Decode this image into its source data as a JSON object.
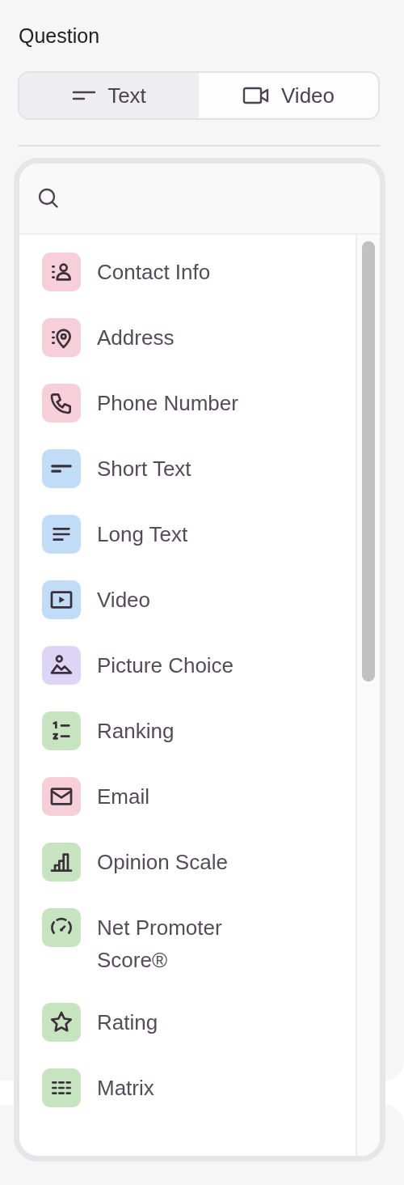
{
  "section_title": "Question",
  "tabs": [
    {
      "label": "Text",
      "selected": true
    },
    {
      "label": "Video",
      "selected": false
    }
  ],
  "question_types": [
    {
      "label": "Contact Info",
      "color": "#f7cfd8"
    },
    {
      "label": "Address",
      "color": "#f7cfd8"
    },
    {
      "label": "Phone Number",
      "color": "#f7cfd8"
    },
    {
      "label": "Short Text",
      "color": "#c0dcf7"
    },
    {
      "label": "Long Text",
      "color": "#c0dcf7"
    },
    {
      "label": "Video",
      "color": "#c0dcf7"
    },
    {
      "label": "Picture Choice",
      "color": "#ddd5f5"
    },
    {
      "label": "Ranking",
      "color": "#c6e4bf"
    },
    {
      "label": "Email",
      "color": "#f7cfd8"
    },
    {
      "label": "Opinion Scale",
      "color": "#c6e4bf"
    },
    {
      "label": "Net Promoter Score®",
      "color": "#c6e4bf"
    },
    {
      "label": "Rating",
      "color": "#c6e4bf"
    },
    {
      "label": "Matrix",
      "color": "#c6e4bf"
    }
  ]
}
